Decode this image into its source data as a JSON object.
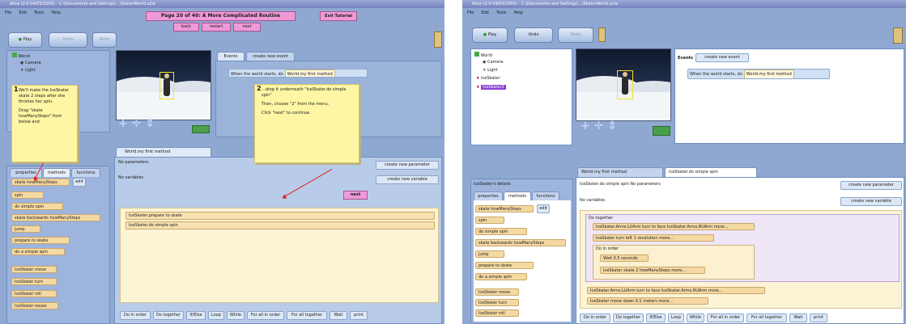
{
  "left": {
    "title": "Alice (2.0 04/05/2005) - C:\\Documents and Settings\\...\\SkaterWorld.a2w",
    "menu": [
      "File",
      "Edit",
      "Tools",
      "Help"
    ],
    "tutorial": {
      "page": "Page 20 of 40: A More Complicated Routine",
      "exit": "Exit Tutorial",
      "back": "back",
      "restart": "restart",
      "next": "next"
    },
    "toolbar": {
      "play": "Play",
      "undo": "Undo",
      "redo": "Redo"
    },
    "tree": [
      "World",
      "Camera",
      "Light"
    ],
    "events": {
      "tab1": "Events",
      "tab2": "create new event",
      "event_text": "When the world starts, do",
      "event_value": "World.my first method"
    },
    "notes": [
      {
        "num": "1",
        "lines": [
          "We'll make the IceSkater skate 2 steps after she finishes her spin.",
          "Drag \"skate howManySteps\" from below and"
        ]
      },
      {
        "num": "2",
        "lines": [
          "...drop it underneath \"IceSkater.do simple spin\"",
          "Then, choose \"2\" from the menu.",
          "Click \"next\" to continue."
        ]
      }
    ],
    "next_hint": "next",
    "details_tabs": [
      "properties",
      "methods",
      "functions"
    ],
    "method_tiles": [
      "skate howManySteps",
      "spin",
      "do simple spin",
      "skate backwards howManySteps",
      "jump",
      "prepare to skate",
      "do a simple spin"
    ],
    "more_tiles": [
      "IceSkater move",
      "IceSkater turn",
      "IceSkater roll",
      "IceSkater resize"
    ],
    "edit_btn": "edit",
    "editor_tab": "World.my first method",
    "editor_params": "No parameters",
    "editor_vars": "No variables",
    "editor_btns": [
      "create new parameter",
      "create new variable"
    ],
    "editor_lines": [
      "IceSkater.prepare to skate",
      "IceSkater.do simple spin"
    ],
    "bottom_bar": [
      "Do in order",
      "Do together",
      "If/Else",
      "Loop",
      "While",
      "For all in order",
      "For all together",
      "Wait",
      "print"
    ]
  },
  "right": {
    "title": "Alice (2.0 04/05/2005) - C:\\Documents and Settings\\...\\SkaterWorld.a2w",
    "menu": [
      "File",
      "Edit",
      "Tools",
      "Help"
    ],
    "toolbar": {
      "play": "Play",
      "undo": "Undo",
      "redo": "Redo"
    },
    "tree": [
      "World",
      "Camera",
      "Light",
      "IceSkater",
      "IceSkater2"
    ],
    "events": {
      "label": "Events",
      "create": "create new event",
      "event_text": "When the world starts, do",
      "event_value": "World.my first method"
    },
    "details_title": "IceSkater's details",
    "details_tabs": [
      "properties",
      "methods",
      "functions"
    ],
    "method_tiles": [
      "skate howManySteps",
      "spin",
      "do simple spin",
      "skate backwards howManySteps",
      "jump",
      "prepare to skate",
      "do a simple spin"
    ],
    "more_tiles": [
      "IceSkater move",
      "IceSkater turn",
      "IceSkater roll",
      "IceSkater resize"
    ],
    "edit_btn": "edit",
    "editor_tabs": [
      "World.my first method",
      "IceSkater.do simple spin"
    ],
    "editor_header": "IceSkater.do simple spin No parameters",
    "editor_vars": "No variables",
    "editor_btns": [
      "create new parameter",
      "create new variable"
    ],
    "code": {
      "do_together": "Do together",
      "line1": "IceSkater.Arms.LUArm turn to face IceSkater.Arms.RUArm more...",
      "line2": "IceSkater turn left 1 revolution more...",
      "do_in_order": "Do in order",
      "wait": "Wait 0.5 seconds",
      "skate": "IceSkater skate 2 howManySteps more...",
      "line3": "IceSkater.Arms.LUArm turn to face IceSkater.Arms.RUArm more...",
      "line4": "IceSkater move down 0.1 meters more..."
    },
    "bottom_bar": [
      "Do in order",
      "Do together",
      "If/Else",
      "Loop",
      "While",
      "For all in order",
      "For all together",
      "Wait",
      "print"
    ]
  },
  "colors": {
    "chrome": "#8ea8d2",
    "pink": "#ef9ad8",
    "note": "#fef6a4",
    "tile": "#f5d9a3",
    "arrow": "#e02020",
    "code_bg": "#fdf4d5"
  }
}
